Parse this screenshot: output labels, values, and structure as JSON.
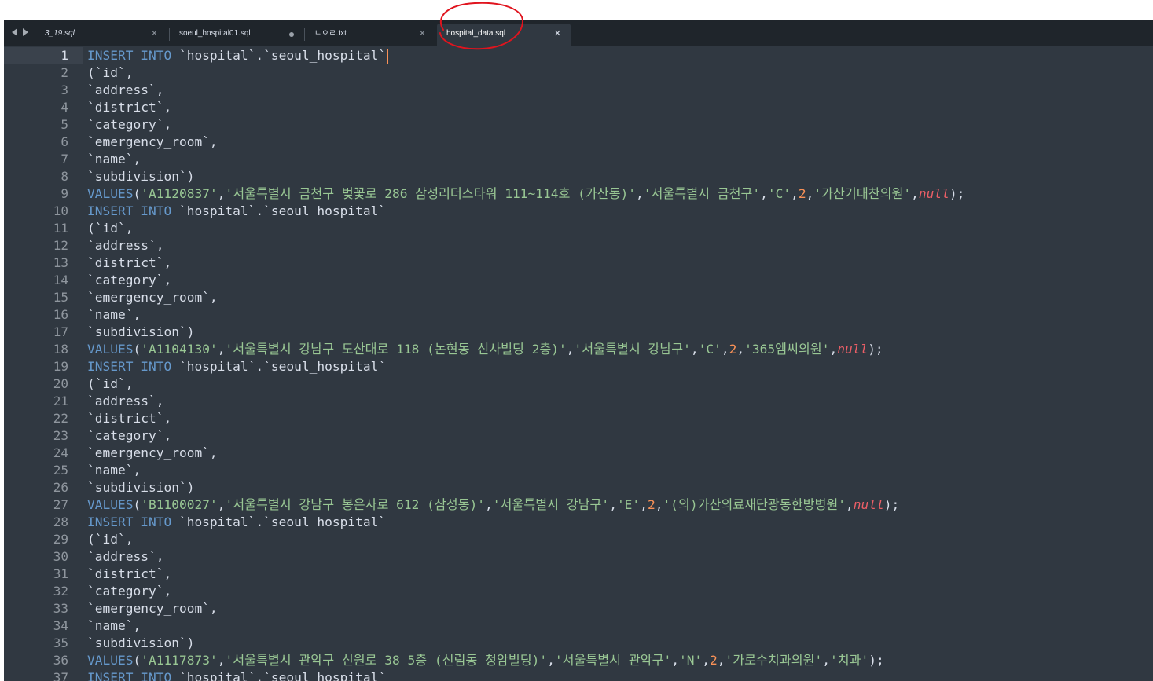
{
  "tabs": [
    {
      "label": "3_19.sql",
      "italic": true,
      "state": "close"
    },
    {
      "label": "soeul_hospital01.sql",
      "italic": false,
      "state": "modified"
    },
    {
      "label": "ㄴㅇㄹ.txt",
      "italic": false,
      "state": "close"
    },
    {
      "label": "hospital_data.sql",
      "italic": false,
      "state": "close",
      "active": true
    }
  ],
  "annotation_color": "#e0141e",
  "colors": {
    "background": "#303841",
    "tabbar": "#1f252b",
    "keyword": "#6699cc",
    "string": "#99c794",
    "number": "#f99157",
    "null": "#ec5f67",
    "text": "#d8dee9"
  },
  "current_line": 1,
  "lines": [
    [
      [
        "kw",
        "INSERT INTO"
      ],
      [
        "bt",
        " `hospital`.`seoul_hospital`"
      ]
    ],
    [
      [
        "bt",
        "(`id`,"
      ]
    ],
    [
      [
        "bt",
        "`address`,"
      ]
    ],
    [
      [
        "bt",
        "`district`,"
      ]
    ],
    [
      [
        "bt",
        "`category`,"
      ]
    ],
    [
      [
        "bt",
        "`emergency_room`,"
      ]
    ],
    [
      [
        "bt",
        "`name`,"
      ]
    ],
    [
      [
        "bt",
        "`subdivision`)"
      ]
    ],
    [
      [
        "kw",
        "VALUES"
      ],
      [
        "pun",
        "("
      ],
      [
        "str",
        "'A1120837'"
      ],
      [
        "pun",
        ","
      ],
      [
        "str",
        "'서울특별시 금천구 벚꽃로 286 삼성리더스타워 111~114호 (가산동)'"
      ],
      [
        "pun",
        ","
      ],
      [
        "str",
        "'서울특별시 금천구'"
      ],
      [
        "pun",
        ","
      ],
      [
        "str",
        "'C'"
      ],
      [
        "pun",
        ","
      ],
      [
        "num",
        "2"
      ],
      [
        "pun",
        ","
      ],
      [
        "str",
        "'가산기대찬의원'"
      ],
      [
        "pun",
        ","
      ],
      [
        "nul",
        "null"
      ],
      [
        "pun",
        ");"
      ]
    ],
    [
      [
        "kw",
        "INSERT INTO"
      ],
      [
        "bt",
        " `hospital`.`seoul_hospital`"
      ]
    ],
    [
      [
        "bt",
        "(`id`,"
      ]
    ],
    [
      [
        "bt",
        "`address`,"
      ]
    ],
    [
      [
        "bt",
        "`district`,"
      ]
    ],
    [
      [
        "bt",
        "`category`,"
      ]
    ],
    [
      [
        "bt",
        "`emergency_room`,"
      ]
    ],
    [
      [
        "bt",
        "`name`,"
      ]
    ],
    [
      [
        "bt",
        "`subdivision`)"
      ]
    ],
    [
      [
        "kw",
        "VALUES"
      ],
      [
        "pun",
        "("
      ],
      [
        "str",
        "'A1104130'"
      ],
      [
        "pun",
        ","
      ],
      [
        "str",
        "'서울특별시 강남구 도산대로 118 (논현동 신사빌딩 2층)'"
      ],
      [
        "pun",
        ","
      ],
      [
        "str",
        "'서울특별시 강남구'"
      ],
      [
        "pun",
        ","
      ],
      [
        "str",
        "'C'"
      ],
      [
        "pun",
        ","
      ],
      [
        "num",
        "2"
      ],
      [
        "pun",
        ","
      ],
      [
        "str",
        "'365엠씨의원'"
      ],
      [
        "pun",
        ","
      ],
      [
        "nul",
        "null"
      ],
      [
        "pun",
        ");"
      ]
    ],
    [
      [
        "kw",
        "INSERT INTO"
      ],
      [
        "bt",
        " `hospital`.`seoul_hospital`"
      ]
    ],
    [
      [
        "bt",
        "(`id`,"
      ]
    ],
    [
      [
        "bt",
        "`address`,"
      ]
    ],
    [
      [
        "bt",
        "`district`,"
      ]
    ],
    [
      [
        "bt",
        "`category`,"
      ]
    ],
    [
      [
        "bt",
        "`emergency_room`,"
      ]
    ],
    [
      [
        "bt",
        "`name`,"
      ]
    ],
    [
      [
        "bt",
        "`subdivision`)"
      ]
    ],
    [
      [
        "kw",
        "VALUES"
      ],
      [
        "pun",
        "("
      ],
      [
        "str",
        "'B1100027'"
      ],
      [
        "pun",
        ","
      ],
      [
        "str",
        "'서울특별시 강남구 봉은사로 612 (삼성동)'"
      ],
      [
        "pun",
        ","
      ],
      [
        "str",
        "'서울특별시 강남구'"
      ],
      [
        "pun",
        ","
      ],
      [
        "str",
        "'E'"
      ],
      [
        "pun",
        ","
      ],
      [
        "num",
        "2"
      ],
      [
        "pun",
        ","
      ],
      [
        "str",
        "'(의)가산의료재단광동한방병원'"
      ],
      [
        "pun",
        ","
      ],
      [
        "nul",
        "null"
      ],
      [
        "pun",
        ");"
      ]
    ],
    [
      [
        "kw",
        "INSERT INTO"
      ],
      [
        "bt",
        " `hospital`.`seoul_hospital`"
      ]
    ],
    [
      [
        "bt",
        "(`id`,"
      ]
    ],
    [
      [
        "bt",
        "`address`,"
      ]
    ],
    [
      [
        "bt",
        "`district`,"
      ]
    ],
    [
      [
        "bt",
        "`category`,"
      ]
    ],
    [
      [
        "bt",
        "`emergency_room`,"
      ]
    ],
    [
      [
        "bt",
        "`name`,"
      ]
    ],
    [
      [
        "bt",
        "`subdivision`)"
      ]
    ],
    [
      [
        "kw",
        "VALUES"
      ],
      [
        "pun",
        "("
      ],
      [
        "str",
        "'A1117873'"
      ],
      [
        "pun",
        ","
      ],
      [
        "str",
        "'서울특별시 관악구 신원로 38 5층 (신림동 청암빌딩)'"
      ],
      [
        "pun",
        ","
      ],
      [
        "str",
        "'서울특별시 관악구'"
      ],
      [
        "pun",
        ","
      ],
      [
        "str",
        "'N'"
      ],
      [
        "pun",
        ","
      ],
      [
        "num",
        "2"
      ],
      [
        "pun",
        ","
      ],
      [
        "str",
        "'가로수치과의원'"
      ],
      [
        "pun",
        ","
      ],
      [
        "str",
        "'치과'"
      ],
      [
        "pun",
        ");"
      ]
    ],
    [
      [
        "kw",
        "INSERT INTO"
      ],
      [
        "bt",
        " `hospital`.`seoul_hospital`"
      ]
    ]
  ]
}
